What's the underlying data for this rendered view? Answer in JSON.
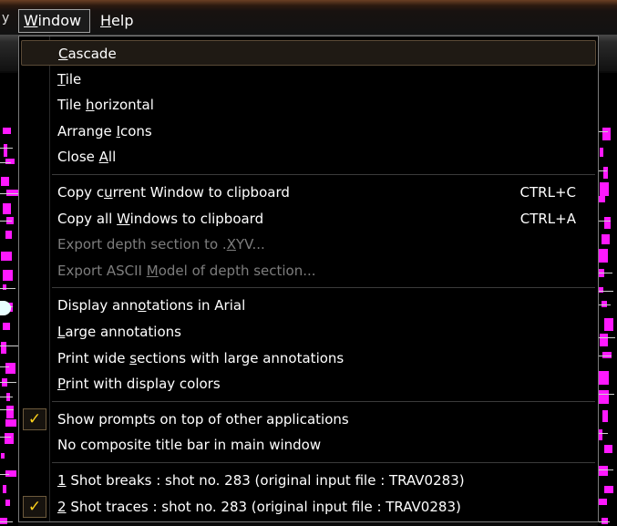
{
  "menubar": {
    "window_label": "Window",
    "window_mnemonic": "W",
    "window_rest": "indow",
    "help_label": "Help",
    "help_mnemonic": "H",
    "help_rest": "elp"
  },
  "menu": {
    "groups": [
      {
        "items": [
          {
            "id": "cascade",
            "pre": "",
            "key": "C",
            "post": "ascade",
            "shortcut": "",
            "enabled": true,
            "checked": false,
            "highlighted": true
          },
          {
            "id": "tile",
            "pre": "",
            "key": "T",
            "post": "ile",
            "shortcut": "",
            "enabled": true,
            "checked": false,
            "highlighted": false
          },
          {
            "id": "tile-horizontal",
            "pre": "Tile ",
            "key": "h",
            "post": "orizontal",
            "shortcut": "",
            "enabled": true,
            "checked": false,
            "highlighted": false
          },
          {
            "id": "arrange-icons",
            "pre": "Arrange ",
            "key": "I",
            "post": "cons",
            "shortcut": "",
            "enabled": true,
            "checked": false,
            "highlighted": false
          },
          {
            "id": "close-all",
            "pre": "Close ",
            "key": "A",
            "post": "ll",
            "shortcut": "",
            "enabled": true,
            "checked": false,
            "highlighted": false
          }
        ]
      },
      {
        "items": [
          {
            "id": "copy-current-window",
            "pre": "Copy c",
            "key": "u",
            "post": "rrent Window to clipboard",
            "shortcut": "CTRL+C",
            "enabled": true,
            "checked": false,
            "highlighted": false
          },
          {
            "id": "copy-all-windows",
            "pre": "Copy all ",
            "key": "W",
            "post": "indows to clipboard",
            "shortcut": "CTRL+A",
            "enabled": true,
            "checked": false,
            "highlighted": false
          },
          {
            "id": "export-depth-section",
            "pre": "Export depth section to .",
            "key": "X",
            "post": "YV...",
            "shortcut": "",
            "enabled": false,
            "checked": false,
            "highlighted": false
          },
          {
            "id": "export-ascii-model",
            "pre": "Export ASCII ",
            "key": "M",
            "post": "odel of depth section...",
            "shortcut": "",
            "enabled": false,
            "checked": false,
            "highlighted": false
          }
        ]
      },
      {
        "items": [
          {
            "id": "display-annotations-arial",
            "pre": "Display ann",
            "key": "o",
            "post": "tations in Arial",
            "shortcut": "",
            "enabled": true,
            "checked": false,
            "highlighted": false
          },
          {
            "id": "large-annotations",
            "pre": "",
            "key": "L",
            "post": "arge annotations",
            "shortcut": "",
            "enabled": true,
            "checked": false,
            "highlighted": false
          },
          {
            "id": "print-wide-sections",
            "pre": "Print wide ",
            "key": "s",
            "post": "ections with large annotations",
            "shortcut": "",
            "enabled": true,
            "checked": false,
            "highlighted": false
          },
          {
            "id": "print-display-colors",
            "pre": "",
            "key": "P",
            "post": "rint with display colors",
            "shortcut": "",
            "enabled": true,
            "checked": false,
            "highlighted": false
          }
        ]
      },
      {
        "items": [
          {
            "id": "show-prompts-on-top",
            "pre": "Show prompts on top of other applications",
            "key": "",
            "post": "",
            "shortcut": "",
            "enabled": true,
            "checked": true,
            "highlighted": false
          },
          {
            "id": "no-composite-title-bar",
            "pre": "No composite title bar in main window",
            "key": "",
            "post": "",
            "shortcut": "",
            "enabled": true,
            "checked": false,
            "highlighted": false
          }
        ]
      },
      {
        "items": [
          {
            "id": "window-1-shot-breaks",
            "pre": "",
            "key": "1",
            "post": " Shot breaks : shot no. 283 (original input file : TRAV0283)",
            "shortcut": "",
            "enabled": true,
            "checked": false,
            "highlighted": false
          },
          {
            "id": "window-2-shot-traces",
            "pre": "",
            "key": "2",
            "post": " Shot traces : shot no. 283 (original input file : TRAV0283)",
            "shortcut": "",
            "enabled": true,
            "checked": true,
            "highlighted": false
          }
        ]
      }
    ],
    "check_glyph": "✓"
  },
  "colors": {
    "accent_check": "#ffd21c",
    "menu_background": "#000000",
    "disabled_text": "#7d7d7d",
    "trace_magenta": "#ff19ff"
  }
}
